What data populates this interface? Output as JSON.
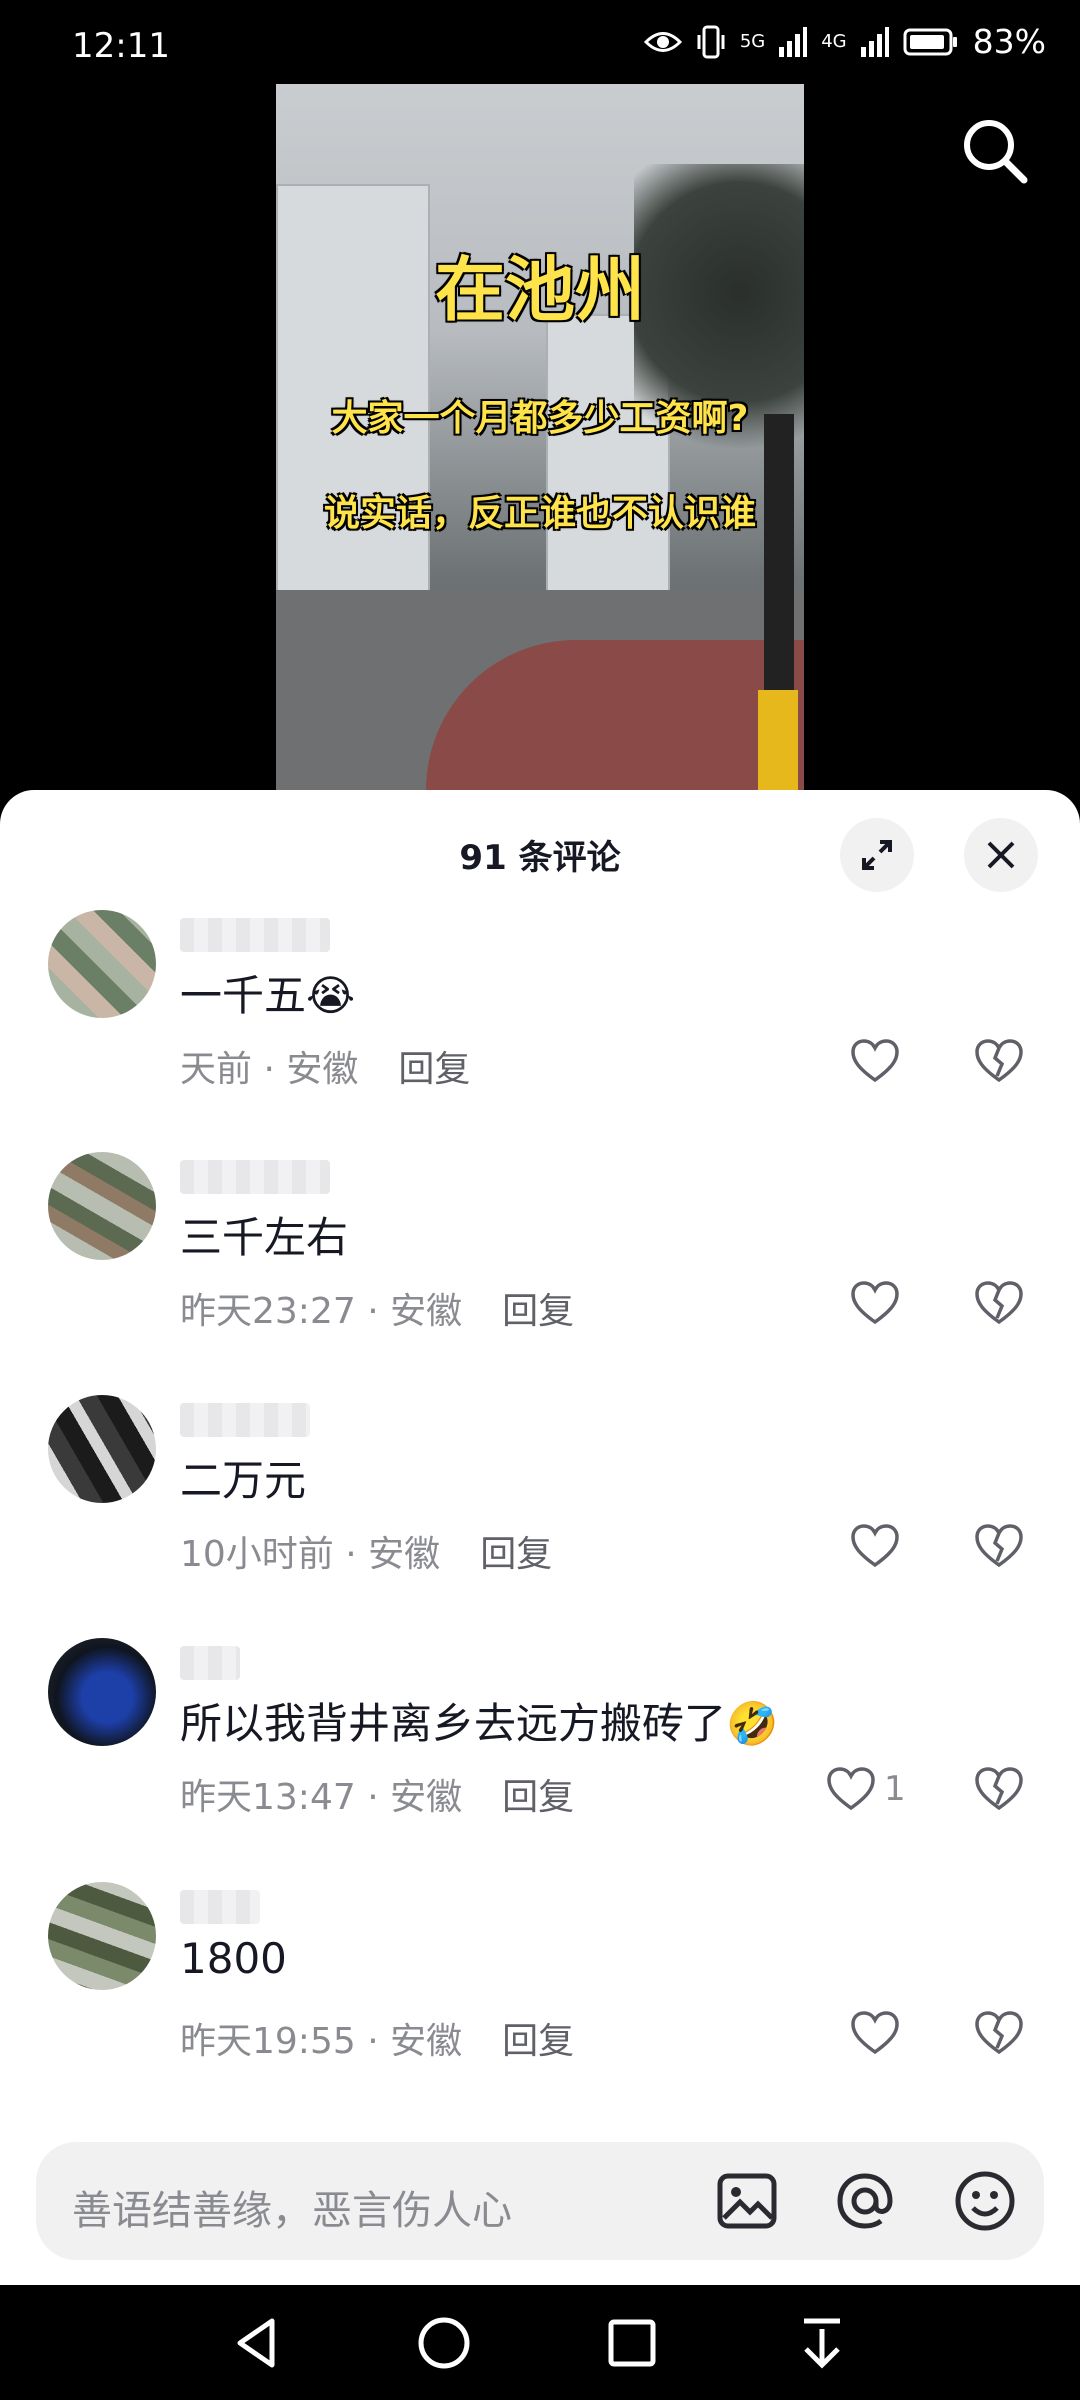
{
  "status_bar": {
    "time": "12:11",
    "net1": "5G",
    "net2": "4G",
    "battery": "83%"
  },
  "video": {
    "overlay_title": "在池州",
    "overlay_line1": "大家一个月都多少工资啊?",
    "overlay_line2": "说实话，反正谁也不认识谁"
  },
  "sheet": {
    "title": "91 条评论"
  },
  "comments": [
    {
      "text": "一千五😭",
      "time": "天前",
      "location": "安徽",
      "reply": "回复",
      "likes": ""
    },
    {
      "text": "三千左右",
      "time": "昨天23:27",
      "location": "安徽",
      "reply": "回复",
      "likes": ""
    },
    {
      "text": "二万元",
      "time": "10小时前",
      "location": "安徽",
      "reply": "回复",
      "likes": ""
    },
    {
      "text": "所以我背井离乡去远方搬砖了🤣",
      "time": "昨天13:47",
      "location": "安徽",
      "reply": "回复",
      "likes": "1"
    },
    {
      "text": "1800",
      "time": "昨天19:55",
      "location": "安徽",
      "reply": "回复",
      "likes": ""
    }
  ],
  "input": {
    "placeholder": "善语结善缘，恶言伤人心"
  },
  "meta_separator": "·",
  "colors": {
    "accent_text": "#161823",
    "muted": "#8a8b91",
    "sheet_bg": "#ffffff"
  }
}
